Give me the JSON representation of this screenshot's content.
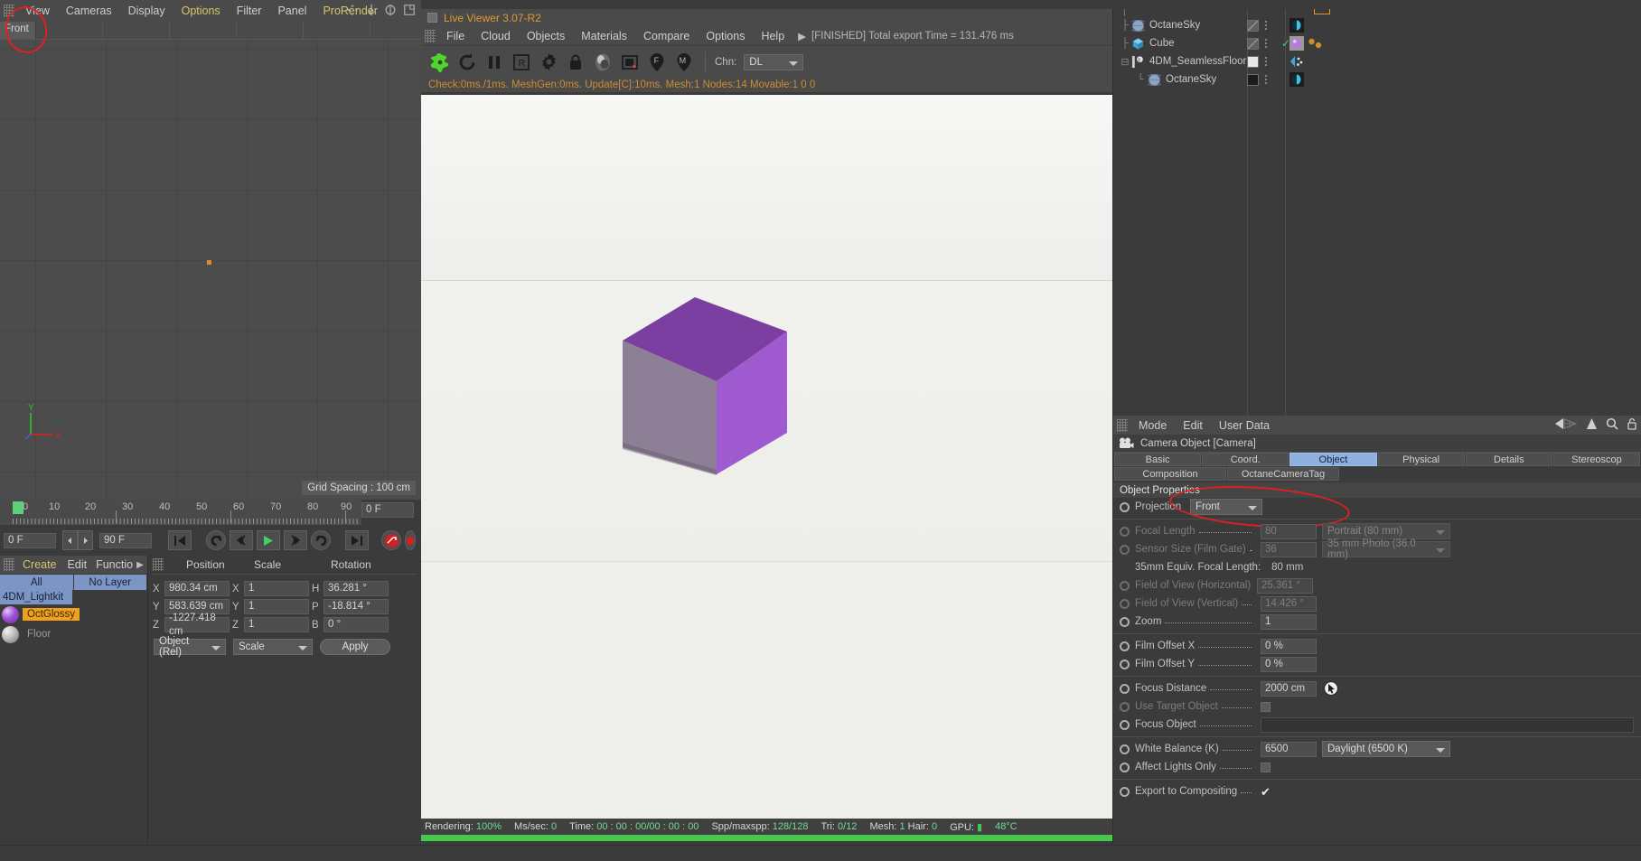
{
  "viewport": {
    "menu": [
      {
        "label": "View",
        "accent": false
      },
      {
        "label": "Cameras",
        "accent": false
      },
      {
        "label": "Display",
        "accent": false
      },
      {
        "label": "Options",
        "accent": true
      },
      {
        "label": "Filter",
        "accent": false
      },
      {
        "label": "Panel",
        "accent": false
      },
      {
        "label": "ProRender",
        "accent": true
      }
    ],
    "view_tab": "Front",
    "grid_spacing": "Grid Spacing : 100 cm",
    "axis": {
      "y": "Y",
      "x": "X"
    }
  },
  "timeline": {
    "ticks": [
      "0",
      "10",
      "20",
      "30",
      "40",
      "50",
      "60",
      "70",
      "80",
      "90"
    ],
    "current_frame_right": "0 F",
    "start_frame": "0 F",
    "end_frame": "90 F"
  },
  "material_manager": {
    "menu": [
      "Create",
      "Edit",
      "Functio"
    ],
    "filters": [
      "All",
      "No Layer"
    ],
    "layer": "4DM_Lightkit",
    "materials": [
      {
        "name": "OctGlossy",
        "selected": true
      },
      {
        "name": "Floor",
        "selected": false
      }
    ]
  },
  "coordinates": {
    "headers": [
      "Position",
      "Scale",
      "Rotation"
    ],
    "rows": [
      {
        "pos_axis": "X",
        "pos": "980.34 cm",
        "sc_axis": "X",
        "scale": "1",
        "rot_axis": "H",
        "rot": "36.281 °"
      },
      {
        "pos_axis": "Y",
        "pos": "583.639 cm",
        "sc_axis": "Y",
        "scale": "1",
        "rot_axis": "P",
        "rot": "-18.814 °"
      },
      {
        "pos_axis": "Z",
        "pos": "-1227.418 cm",
        "sc_axis": "Z",
        "scale": "1",
        "rot_axis": "B",
        "rot": "0 °"
      }
    ],
    "mode_select": "Object (Rel)",
    "scale_select": "Scale",
    "apply_button": "Apply"
  },
  "live_viewer": {
    "title": "Live Viewer 3.07-R2",
    "menu": [
      "File",
      "Cloud",
      "Objects",
      "Materials",
      "Compare",
      "Options",
      "Help"
    ],
    "status": "[FINISHED] Total export Time = 131.476 ms",
    "channel_label": "Chn:",
    "channel_value": "DL",
    "info_line": "Check:0ms./1ms. MeshGen:0ms. Update[C]:10ms. Mesh:1 Nodes:14 Movable:1  0 0",
    "toolbar_icons": [
      "render-start-icon",
      "reload-icon",
      "pause-icon",
      "region-render-icon",
      "settings-gear-icon",
      "lock-icon",
      "material-sphere-icon",
      "picture-region-icon",
      "focus-picker-icon",
      "material-picker-icon"
    ],
    "statusbar": {
      "rendering_label": "Rendering:",
      "rendering_value": "100%",
      "ms_label": "Ms/sec:",
      "ms_value": "0",
      "time_label": "Time:",
      "time_value": "00 : 00 : 00/00 : 00 : 00",
      "spp_label": "Spp/maxspp:",
      "spp_value": "128/128",
      "tri_label": "Tri:",
      "tri_value": "0/12",
      "mesh_label": "Mesh:",
      "mesh_value": "1",
      "hair_label": "Hair:",
      "hair_value": "0",
      "gpu_label": "GPU:",
      "temp_value": "48°C"
    },
    "progress_percent": 100
  },
  "object_manager": {
    "rows": [
      {
        "name": "OctaneSky",
        "icon": "sphere-icon",
        "indent": 1,
        "swatch": "diag",
        "tag": "octane-env-tag",
        "visible_check": false
      },
      {
        "name": "Cube",
        "icon": "cube-icon",
        "indent": 1,
        "swatch": "diag",
        "tag": "material-tag",
        "visible_check": true
      },
      {
        "name": "4DM_SeamlessFloor",
        "icon": "light-object-icon",
        "indent": 0,
        "swatch": "white",
        "tag": "dynamics-tag",
        "visible_check": false
      },
      {
        "name": "OctaneSky",
        "icon": "sphere-icon",
        "indent": 2,
        "swatch": "black",
        "tag": "octane-env-tag",
        "visible_check": false
      }
    ]
  },
  "attributes": {
    "menu": [
      "Mode",
      "Edit",
      "User Data"
    ],
    "object_title": "Camera Object [Camera]",
    "tabs_row1": [
      "Basic",
      "Coord.",
      "Object",
      "Physical",
      "Details",
      "Stereoscop"
    ],
    "tabs_row2": [
      "Composition",
      "OctaneCameraTag"
    ],
    "active_tab": "Object",
    "section_title": "Object Properties",
    "properties": [
      {
        "name": "Projection",
        "type": "combo",
        "value": "Front",
        "enabled": true,
        "highlight": true
      },
      {
        "name": "Focal Length",
        "type": "field-combo",
        "value": "80",
        "combo": "Portrait (80 mm)",
        "enabled": false
      },
      {
        "name": "Sensor Size (Film Gate)",
        "type": "field-combo",
        "value": "36",
        "combo": "35 mm Photo (36.0 mm)",
        "enabled": false
      },
      {
        "name": "35mm Equiv. Focal Length:",
        "type": "static",
        "value": "80 mm",
        "enabled": true
      },
      {
        "name": "Field of View (Horizontal)",
        "type": "field",
        "value": "25.361 °",
        "enabled": false
      },
      {
        "name": "Field of View (Vertical)",
        "type": "field",
        "value": "14.426 °",
        "enabled": false
      },
      {
        "name": "Zoom",
        "type": "field",
        "value": "1",
        "enabled": true
      },
      {
        "name": "Film Offset X",
        "type": "field",
        "value": "0 %",
        "enabled": true
      },
      {
        "name": "Film Offset Y",
        "type": "field",
        "value": "0 %",
        "enabled": true
      },
      {
        "name": "Focus Distance",
        "type": "field-picker",
        "value": "2000 cm",
        "enabled": true
      },
      {
        "name": "Use Target Object",
        "type": "checkbox",
        "checked": false,
        "enabled": false
      },
      {
        "name": "Focus Object",
        "type": "linkbox",
        "value": "",
        "enabled": true
      },
      {
        "name": "White Balance (K)",
        "type": "field-combo",
        "value": "6500",
        "combo": "Daylight (6500 K)",
        "enabled": true
      },
      {
        "name": "Affect Lights Only",
        "type": "checkbox",
        "checked": false,
        "enabled": true
      },
      {
        "name": "Export to Compositing",
        "type": "checkbox",
        "checked": true,
        "enabled": true
      }
    ]
  },
  "colors": {
    "accent_yellow": "#d8c66a",
    "octane_orange": "#e09a30",
    "tab_active_blue": "#8fb0de",
    "material_selected": "#f0a020",
    "progress_green": "#46c84f",
    "cube_top": "#7a3fa0",
    "cube_left": "#8d7f96",
    "cube_right": "#a05ad0",
    "annotation_red": "#e02020"
  }
}
